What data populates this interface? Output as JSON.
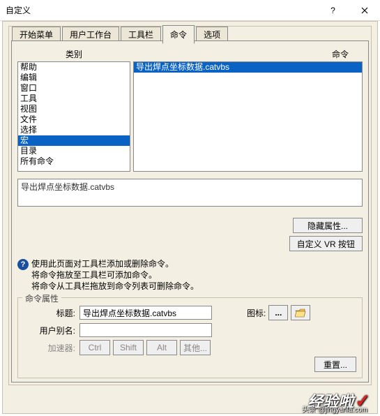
{
  "window": {
    "title": "自定义"
  },
  "tabs": [
    "开始菜单",
    "用户工作台",
    "工具栏",
    "命令",
    "选项"
  ],
  "active_tab": 3,
  "headers": {
    "left": "类别",
    "right": "命令"
  },
  "categories": [
    "帮助",
    "编辑",
    "窗口",
    "工具",
    "视图",
    "文件",
    "选择",
    "宏",
    "目录",
    "所有命令"
  ],
  "selected_category_index": 7,
  "commands": [
    "导出焊点坐标数据.catvbs"
  ],
  "selected_command_index": 0,
  "description": "导出焊点坐标数据.catvbs",
  "buttons": {
    "hide_props": "隐藏属性...",
    "custom_vr": "自定义 VR 按钮"
  },
  "info": {
    "line1": "使用此页面对工具栏添加或删除命令。",
    "line2": "将命令拖放至工具栏可添加命令。",
    "line3": "将命令从工具栏拖放到命令列表可删除命令。"
  },
  "props": {
    "legend": "命令属性",
    "label_title": "标题:",
    "title_value": "导出焊点坐标数据.catvbs",
    "label_alias": "用户别名:",
    "alias_value": "",
    "label_accel": "加速器:",
    "icon_label": "图标:",
    "accel_btns": [
      "Ctrl",
      "Shift",
      "Alt",
      "其他..."
    ],
    "reset": "重置..."
  },
  "watermark": {
    "main": "经验啦",
    "sub": "头条 @jingyanla.com"
  }
}
